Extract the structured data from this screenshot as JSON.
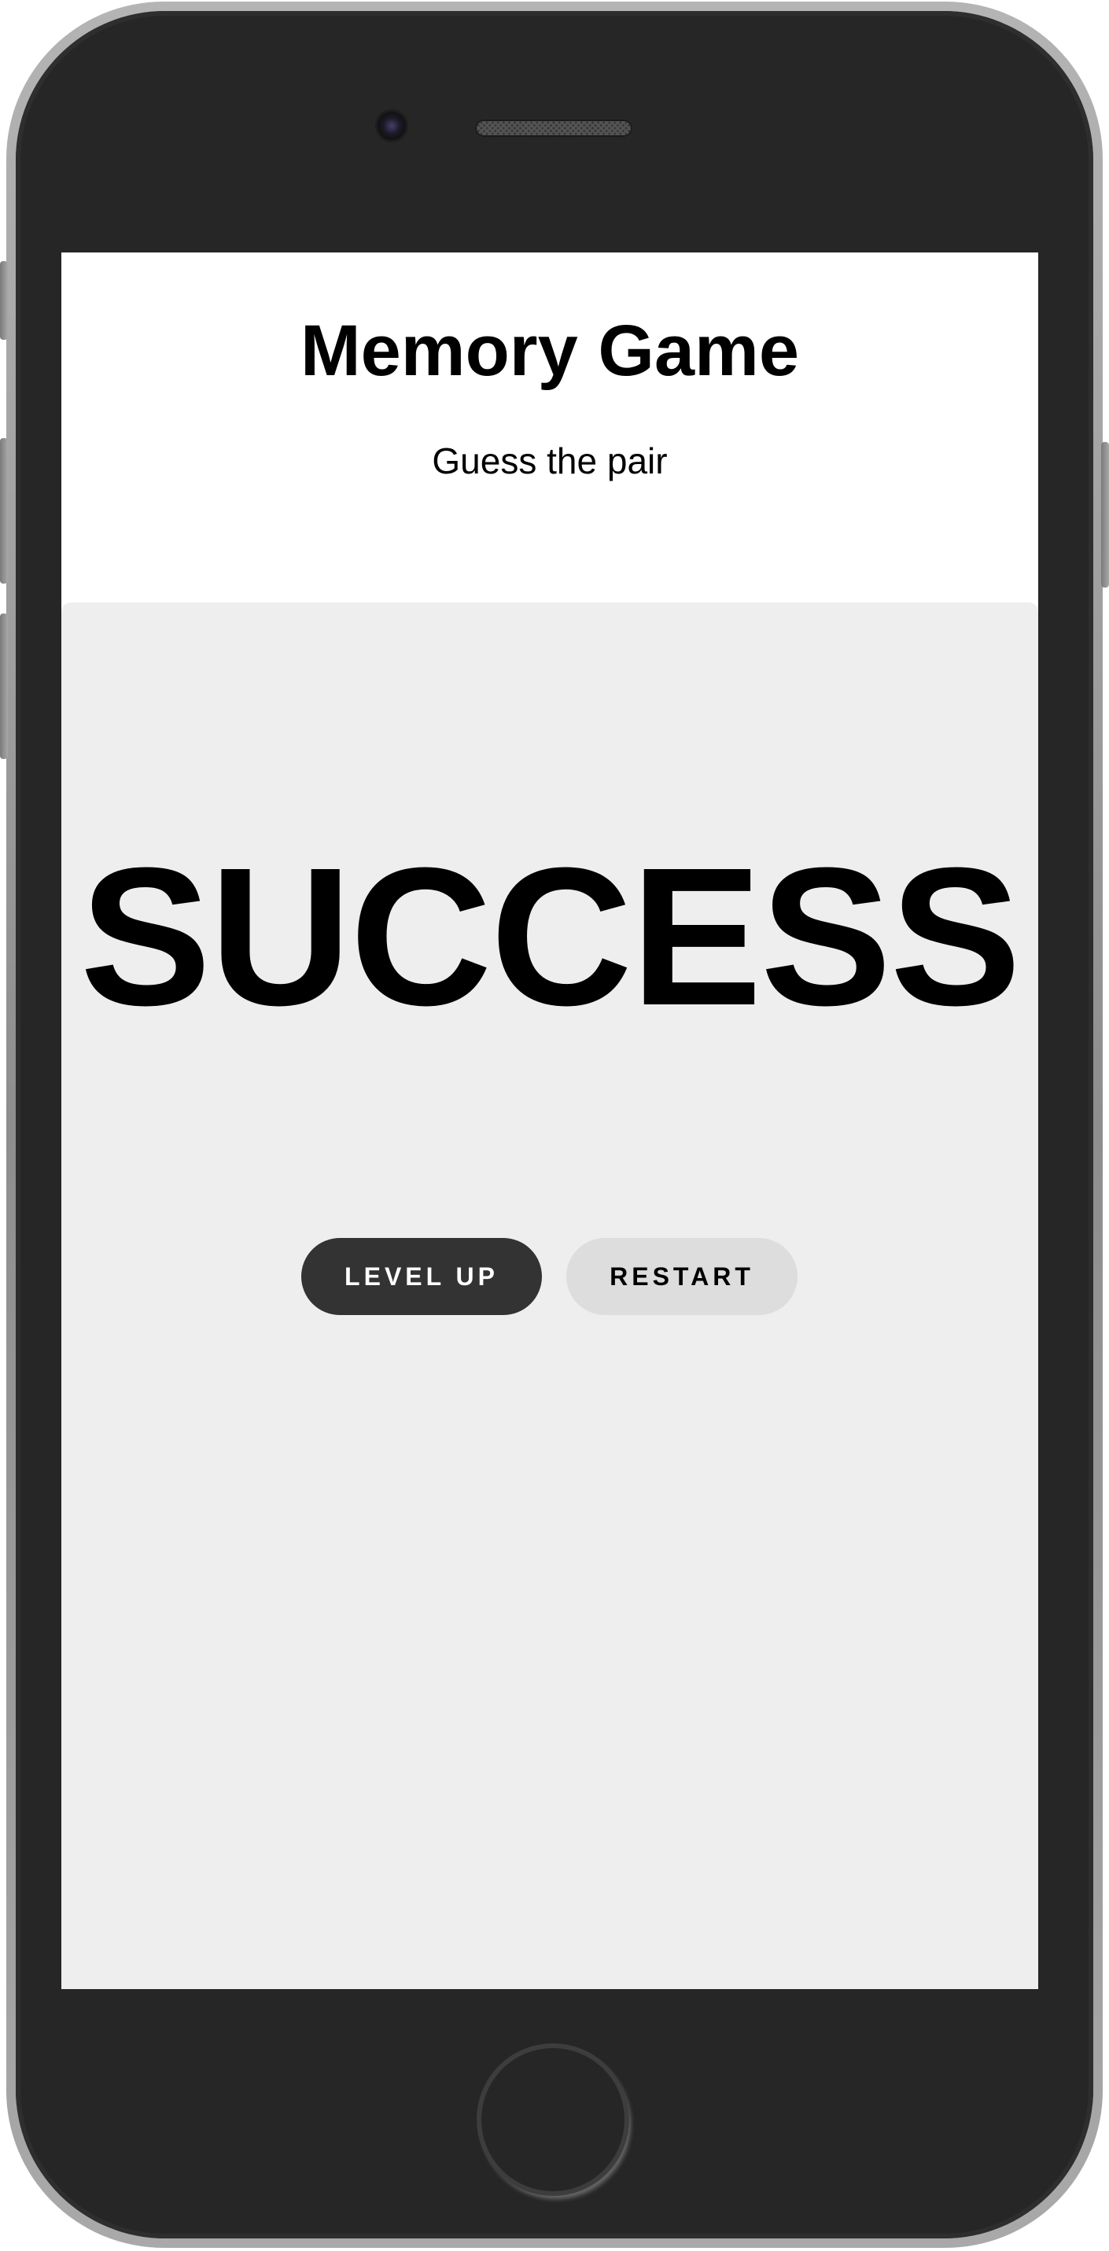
{
  "app": {
    "title": "Memory Game",
    "subtitle": "Guess the pair"
  },
  "result": {
    "message": "SUCCESS"
  },
  "actions": {
    "level_up_label": "LEVEL UP",
    "restart_label": "RESTART"
  },
  "colors": {
    "board_background": "#eeeeee",
    "primary_button": "#333333",
    "secondary_button": "#dddddd",
    "phone_body": "#262626"
  },
  "icons": {
    "camera": "front-camera-icon",
    "speaker": "earpiece-speaker-icon",
    "home": "home-button-icon"
  }
}
